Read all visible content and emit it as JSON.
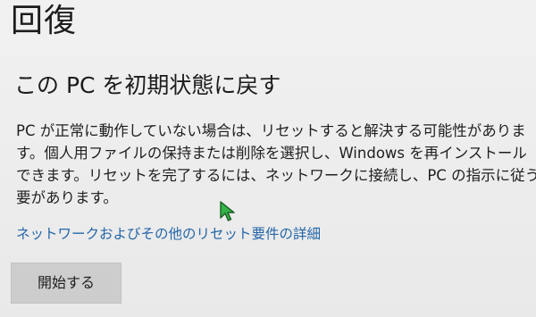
{
  "page": {
    "title": "回復",
    "subtitle": "この PC を初期状態に戻す",
    "description_lines": [
      "PC が正常に動作していない場合は、リセットすると解決する可能性がありま",
      "す。個人用ファイルの保持または削除を選択し、Windows を再インストール",
      "できます。リセットを完了するには、ネットワークに接続し、PC の指示に従う必",
      "要があります。"
    ],
    "link_text": "ネットワークおよびその他のリセット要件の詳細",
    "button_label": "開始する"
  },
  "colors": {
    "background": "#ececec",
    "text": "#1a1a1a",
    "link": "#2466a8",
    "button": "#cdcdcd",
    "cursor_fill": "#34b348"
  },
  "icons": {
    "cursor": "mouse-pointer-icon"
  }
}
